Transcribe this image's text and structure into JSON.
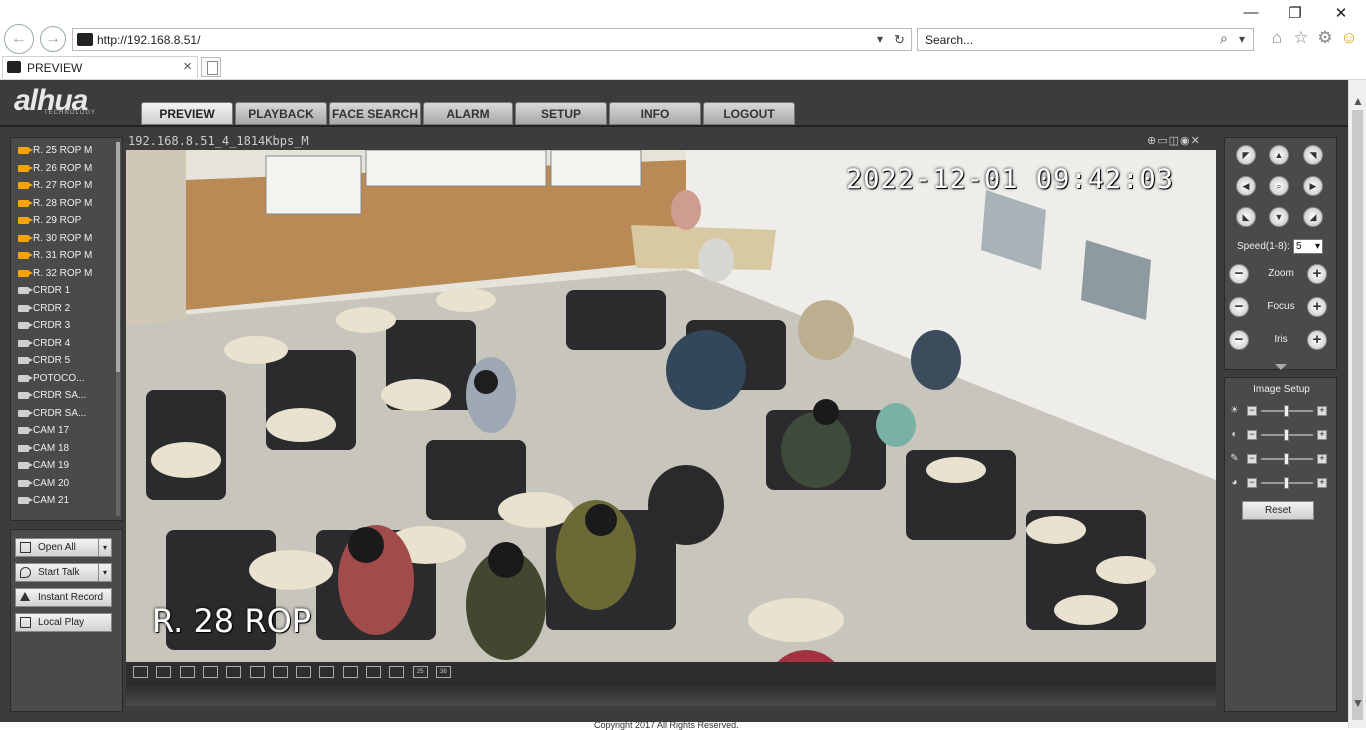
{
  "browser": {
    "url": "http://192.168.8.51/",
    "search_placeholder": "Search...",
    "tab_title": "PREVIEW",
    "tab_close": "×",
    "win_minimize": "—",
    "win_restore": "❐",
    "win_close": "✕",
    "back_glyph": "←",
    "forward_glyph": "→",
    "addr_dropdown": "▾",
    "addr_refresh": "↻",
    "search_glyph": "⌕",
    "search_dropdown": "▾",
    "home_glyph": "⌂",
    "star_glyph": "☆",
    "gear_glyph": "⚙",
    "smiley_glyph": "☺",
    "scroll_up": "▲",
    "scroll_down": "▼"
  },
  "app": {
    "logo": "alhua",
    "logo_sub": "TECHNOLOGY",
    "menu": [
      "PREVIEW",
      "PLAYBACK",
      "FACE SEARCH",
      "ALARM",
      "SETUP",
      "INFO",
      "LOGOUT"
    ],
    "active_menu": "PREVIEW"
  },
  "cameras": [
    {
      "label": "R. 25 ROP   M",
      "on": true
    },
    {
      "label": "R. 26 ROP   M",
      "on": true
    },
    {
      "label": "R. 27 ROP   M",
      "on": true
    },
    {
      "label": "R. 28 ROP   M",
      "on": true
    },
    {
      "label": "R. 29 ROP",
      "on": true
    },
    {
      "label": "R. 30 ROP   M",
      "on": true
    },
    {
      "label": "R. 31 ROP   M",
      "on": true
    },
    {
      "label": "R. 32 ROP   M",
      "on": true
    },
    {
      "label": "CRDR 1",
      "on": false
    },
    {
      "label": "CRDR 2",
      "on": false
    },
    {
      "label": "CRDR 3",
      "on": false
    },
    {
      "label": "CRDR 4",
      "on": false
    },
    {
      "label": "CRDR 5",
      "on": false
    },
    {
      "label": "POTOCO...",
      "on": false
    },
    {
      "label": "CRDR SA...",
      "on": false
    },
    {
      "label": "CRDR SA...",
      "on": false
    },
    {
      "label": "CAM 17",
      "on": false
    },
    {
      "label": "CAM 18",
      "on": false
    },
    {
      "label": "CAM 19",
      "on": false
    },
    {
      "label": "CAM 20",
      "on": false
    },
    {
      "label": "CAM 21",
      "on": false
    }
  ],
  "actions": {
    "open_all": "Open All",
    "start_talk": "Start Talk",
    "instant_record": "Instant Record",
    "local_play": "Local Play",
    "dropdown_glyph": "▾"
  },
  "viewer": {
    "stream_title": "192.168.8.51_4_1814Kbps_M",
    "icons_glyph": "⊕▭◫◉✕",
    "osd_datetime": "2022-12-01  09:42:03",
    "osd_camera": "R. 28 ROP",
    "layouts": [
      "",
      "",
      "",
      "",
      "",
      "",
      "",
      "",
      "",
      "",
      "",
      "",
      "25",
      "36"
    ]
  },
  "ptz": {
    "arrows": [
      "◤",
      "▲",
      "◥",
      "◀",
      "⌕",
      "▶",
      "◣",
      "▼",
      "◢"
    ],
    "speed_label": "Speed(1-8):",
    "speed_value": "5",
    "zoom": "Zoom",
    "focus": "Focus",
    "iris": "Iris",
    "minus": "−",
    "plus": "+"
  },
  "image_setup": {
    "title": "Image Setup",
    "rows": [
      {
        "icon": "☀",
        "level": 0.5
      },
      {
        "icon": "◐",
        "level": 0.5
      },
      {
        "icon": "✎",
        "level": 0.5
      },
      {
        "icon": "◕",
        "level": 0.5
      }
    ],
    "minus": "−",
    "plus": "+",
    "reset": "Reset"
  },
  "footer": {
    "copyright": "Copyright 2017 All Rights Reserved."
  }
}
